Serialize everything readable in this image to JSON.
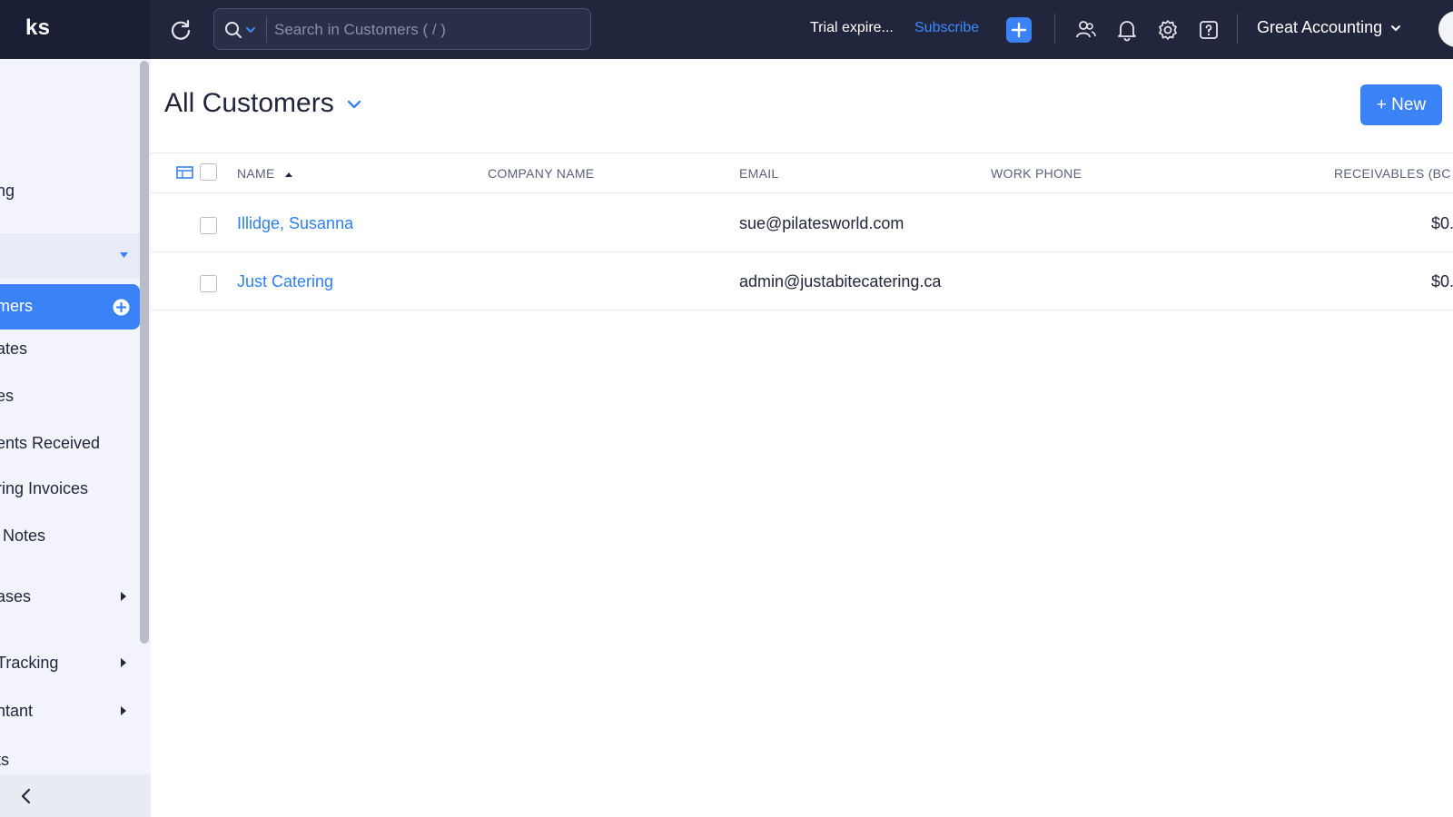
{
  "topbar": {
    "brand": "ks",
    "search_placeholder": "Search in Customers ( / )",
    "trial_text": "Trial expire...",
    "subscribe_label": "Subscribe",
    "org_name": "Great Accounting"
  },
  "sidebar": {
    "items": [
      {
        "label": "ng"
      },
      {
        "label": "mers"
      },
      {
        "label": "ates"
      },
      {
        "label": "es"
      },
      {
        "label": "ents Received"
      },
      {
        "label": "ring Invoices"
      },
      {
        "label": " Notes"
      },
      {
        "label": "ases"
      },
      {
        "label": "Tracking"
      },
      {
        "label": "ntant"
      },
      {
        "label": "ts"
      }
    ]
  },
  "main": {
    "title": "All Customers",
    "new_label": "+ New",
    "columns": [
      "NAME",
      "COMPANY NAME",
      "EMAIL",
      "WORK PHONE",
      "RECEIVABLES (BC"
    ],
    "rows": [
      {
        "name": "Illidge, Susanna",
        "company": "",
        "email": "sue@pilatesworld.com",
        "phone": "",
        "receivables": "$0."
      },
      {
        "name": "Just Catering",
        "company": "",
        "email": "admin@justabitecatering.ca",
        "phone": "",
        "receivables": "$0."
      }
    ]
  },
  "colors": {
    "topbar": "#21263c",
    "accent": "#3b82f6",
    "link": "#2f7ff0",
    "sidebar_bg": "#f3f4fb"
  }
}
